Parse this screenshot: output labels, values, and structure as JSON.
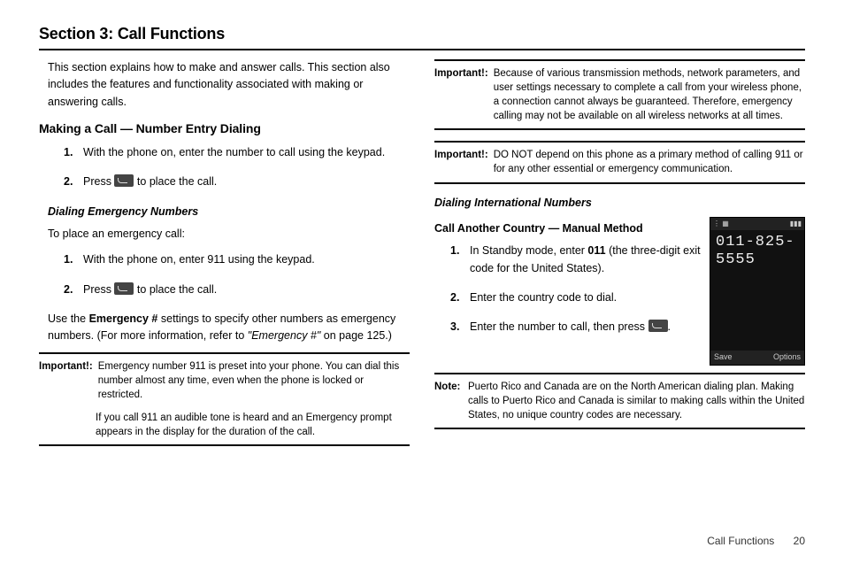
{
  "section_title": "Section 3: Call Functions",
  "intro": "This section explains how to make and answer calls. This section also includes the features and functionality associated with making or answering calls.",
  "making_call": {
    "heading": "Making a Call — Number Entry Dialing",
    "steps": {
      "s1_num": "1.",
      "s1": "With the phone on, enter the number to call using the keypad.",
      "s2_num": "2.",
      "s2_pre": "Press ",
      "s2_post": " to place the call."
    }
  },
  "emergency": {
    "heading": "Dialing Emergency Numbers",
    "intro": "To place an emergency call:",
    "steps": {
      "s1_num": "1.",
      "s1": "With the phone on, enter 911 using the keypad.",
      "s2_num": "2.",
      "s2_pre": "Press ",
      "s2_post": " to place the call."
    },
    "after_pre": "Use the ",
    "after_bold": "Emergency #",
    "after_mid": " settings to specify other numbers as emergency numbers. (For more information, refer to ",
    "after_ref": "\"Emergency #\"",
    "after_post": " on page 125.)"
  },
  "important1": {
    "label": "Important!:",
    "p1": "Emergency number 911 is preset into your phone. You can dial this number almost any time, even when the phone is locked or restricted.",
    "p2": "If you call 911 an audible tone is heard and an Emergency prompt appears in the display for the duration of the call."
  },
  "important2": {
    "label": "Important!:",
    "p1": "Because of various transmission methods, network parameters, and user settings necessary to complete a call from your wireless phone, a connection cannot always be guaranteed. Therefore, emergency calling may not be available on all wireless networks at all times."
  },
  "important3": {
    "label": "Important!:",
    "p1": "DO NOT depend on this phone as a primary method of calling 911 or for any other essential or emergency communication."
  },
  "international": {
    "heading": "Dialing International Numbers",
    "sub": "Call Another Country — Manual Method",
    "steps": {
      "s1_num": "1.",
      "s1_pre": "In Standby mode, enter ",
      "s1_bold": "011",
      "s1_post": " (the three-digit exit code for the United States).",
      "s2_num": "2.",
      "s2": "Enter the country code to dial.",
      "s3_num": "3.",
      "s3_pre": "Enter the number to call, then press ",
      "s3_post": "."
    }
  },
  "phone": {
    "status_left": "⋮ ▦",
    "status_right": "▮▮▮",
    "number_l1": "011-825-",
    "number_l2": "5555",
    "soft_left": "Save",
    "soft_right": "Options"
  },
  "note": {
    "label": "Note:",
    "p1": "Puerto Rico and Canada are on the North American dialing plan. Making calls to Puerto Rico and Canada is similar to making calls within the United States, no unique country codes are necessary."
  },
  "footer": {
    "section": "Call Functions",
    "page": "20"
  }
}
